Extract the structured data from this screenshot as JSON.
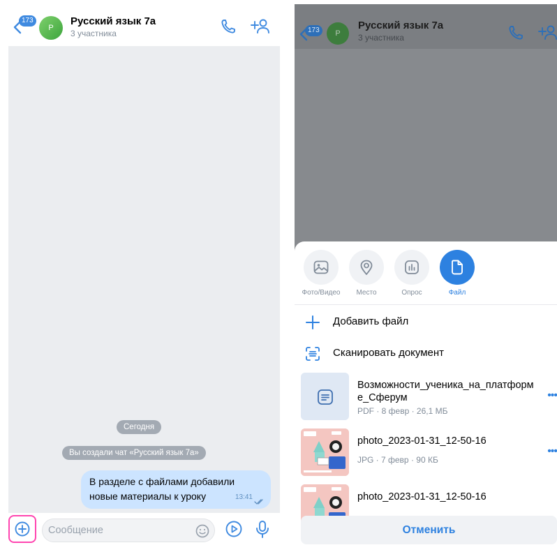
{
  "chat": {
    "unread_badge": "173",
    "avatar_letter": "Р",
    "title": "Русский язык 7а",
    "subtitle": "3 участника",
    "date_pill": "Сегодня",
    "system_message": "Вы создали чат «Русский язык 7а»",
    "message": {
      "text": "В разделе с файлами добавили\nновые материалы к уроку",
      "time": "13:41"
    },
    "input_placeholder": "Сообщение",
    "colors": {
      "accent": "#3f8ae0",
      "bubble": "#cce4ff",
      "highlight": "#ff45b0",
      "chat_bg": "#ebedf0"
    },
    "icons": [
      "back-icon",
      "phone-icon",
      "add-user-icon",
      "plus-circle-icon",
      "smile-icon",
      "video-message-icon",
      "microphone-icon",
      "double-check-icon"
    ]
  },
  "sheet": {
    "attachments": [
      {
        "label": "Фото/Видео",
        "icon": "image-icon"
      },
      {
        "label": "Место",
        "icon": "location-icon"
      },
      {
        "label": "Опрос",
        "icon": "poll-icon"
      },
      {
        "label": "Файл",
        "icon": "file-icon",
        "selected": true
      }
    ],
    "actions": [
      {
        "label": "Добавить файл",
        "icon": "plus-icon"
      },
      {
        "label": "Сканировать документ",
        "icon": "scan-icon"
      }
    ],
    "files": [
      {
        "name": "Возможности_ученика_на_платформе_Сферум",
        "meta": "PDF · 8 февр · 26,1 МБ",
        "thumb": "document-icon"
      },
      {
        "name": "photo_2023-01-31_12-50-16",
        "meta": "JPG · 7 февр · 90 КБ",
        "thumb": "photo-thumbnail"
      },
      {
        "name": "photo_2023-01-31_12-50-16",
        "meta": "",
        "thumb": "photo-thumbnail"
      }
    ],
    "cancel_label": "Отменить"
  }
}
